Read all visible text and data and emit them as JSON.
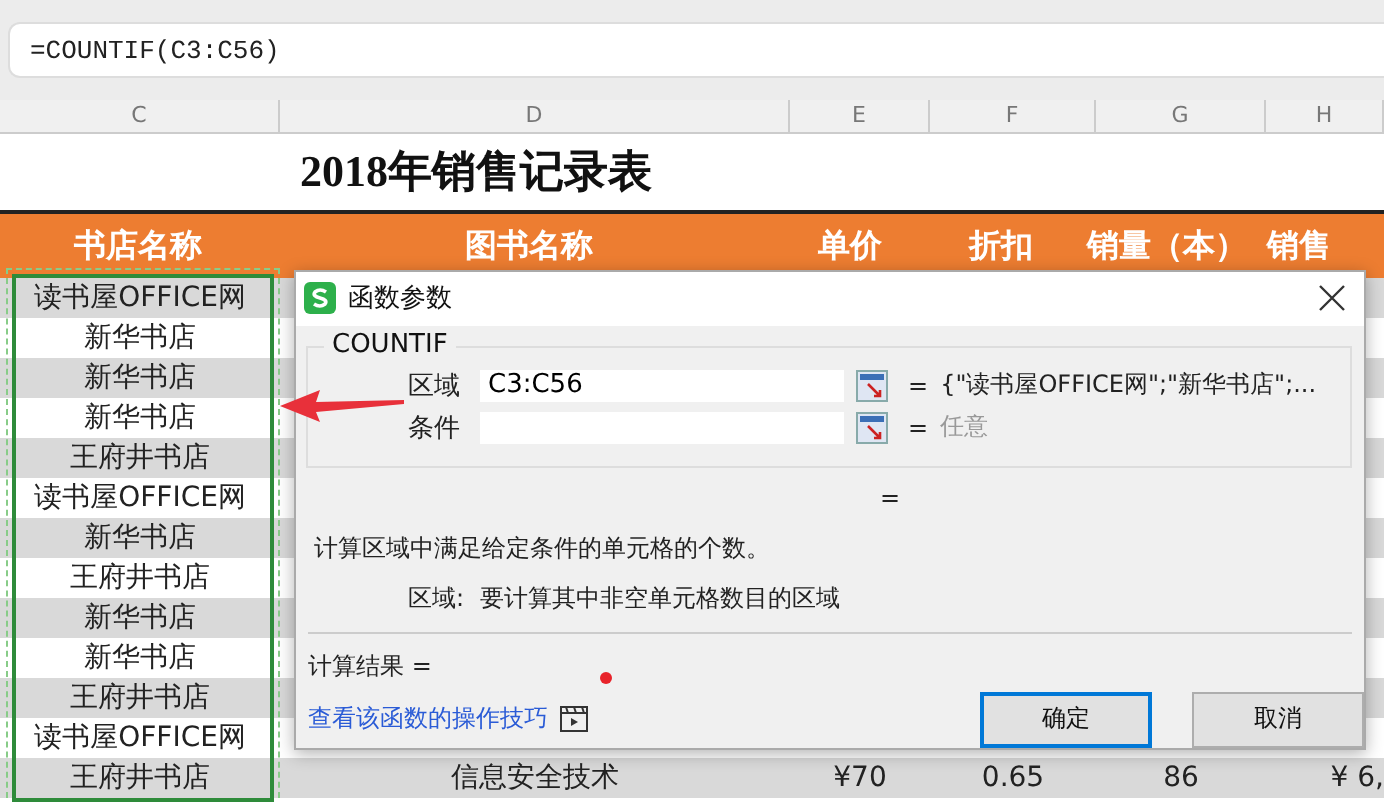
{
  "formula_bar": {
    "value": "=COUNTIF(C3:C56)"
  },
  "column_letters": [
    "C",
    "D",
    "E",
    "F",
    "G",
    "H"
  ],
  "title": "2018年销售记录表",
  "table": {
    "columns": [
      {
        "label": "书店名称",
        "marked": true
      },
      {
        "label": "图书名称",
        "marked": false
      },
      {
        "label": "单价",
        "marked": false
      },
      {
        "label": "折扣",
        "marked": false
      },
      {
        "label": "销量（本）",
        "marked": false
      },
      {
        "label": "销售",
        "marked": false
      }
    ],
    "rows": [
      {
        "cells": [
          "读书屋OFFICE网"
        ]
      },
      {
        "cells": [
          "新华书店"
        ]
      },
      {
        "cells": [
          "新华书店"
        ]
      },
      {
        "cells": [
          "新华书店"
        ]
      },
      {
        "cells": [
          "王府井书店"
        ]
      },
      {
        "cells": [
          "读书屋OFFICE网"
        ]
      },
      {
        "cells": [
          "新华书店"
        ]
      },
      {
        "cells": [
          "王府井书店"
        ]
      },
      {
        "cells": [
          "新华书店"
        ]
      },
      {
        "cells": [
          "新华书店"
        ]
      },
      {
        "cells": [
          "王府井书店"
        ]
      },
      {
        "cells": [
          "读书屋OFFICE网"
        ]
      },
      {
        "cells": [
          "王府井书店",
          "信息安全技术",
          "¥70",
          "0.65",
          "86",
          "¥  6,"
        ]
      }
    ]
  },
  "dialog": {
    "title": "函数参数",
    "function_name": "COUNTIF",
    "args": [
      {
        "label": "区域",
        "value": "C3:C56",
        "eq": "=",
        "result": "{\"读书屋OFFICE网\";\"新华书店\";...",
        "hint": false
      },
      {
        "label": "条件",
        "eq": "=",
        "result": "任意",
        "hint": true
      }
    ],
    "result_eq": "=",
    "description": "计算区域中满足给定条件的单元格的个数。",
    "arg_help_label": "区域:",
    "arg_help": "要计算其中非空单元格数目的区域",
    "result_label": "计算结果 =",
    "link": "查看该函数的操作技巧",
    "buttons": [
      {
        "label": "确定",
        "default": true
      },
      {
        "label": "取消",
        "default": false
      }
    ]
  }
}
